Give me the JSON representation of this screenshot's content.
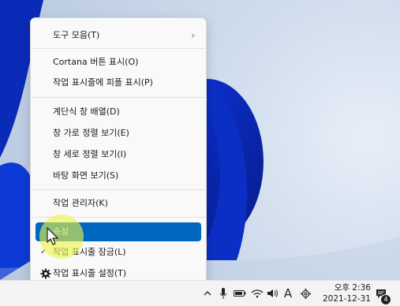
{
  "context_menu": {
    "items": [
      {
        "label": "도구 모음(T)",
        "has_submenu": true
      },
      {
        "label": "Cortana 버튼 표시(O)"
      },
      {
        "label": "작업 표시줄에 피플 표시(P)"
      },
      {
        "label": "계단식 창 배열(D)"
      },
      {
        "label": "창 가로 정렬 보기(E)"
      },
      {
        "label": "창 세로 정렬 보기(I)"
      },
      {
        "label": "바탕 화면 보기(S)"
      },
      {
        "label": "작업 관리자(K)"
      },
      {
        "label": "속성",
        "selected": true
      },
      {
        "label": "작업 표시줄 잠금(L)",
        "checked": true
      },
      {
        "label": "작업 표시줄 설정(T)",
        "icon": "gear-icon"
      }
    ]
  },
  "taskbar": {
    "tray_icons": [
      "chevron-up-icon",
      "microphone-icon",
      "battery-icon",
      "wifi-icon",
      "speaker-icon",
      "ime-icon",
      "settings-icon"
    ],
    "ime_label": "A",
    "time": "오후 2:36",
    "date": "2021-12-31",
    "notification_count": "4"
  },
  "colors": {
    "selection": "#0067c0",
    "wallpaper_blue": "#0a2fd0"
  }
}
